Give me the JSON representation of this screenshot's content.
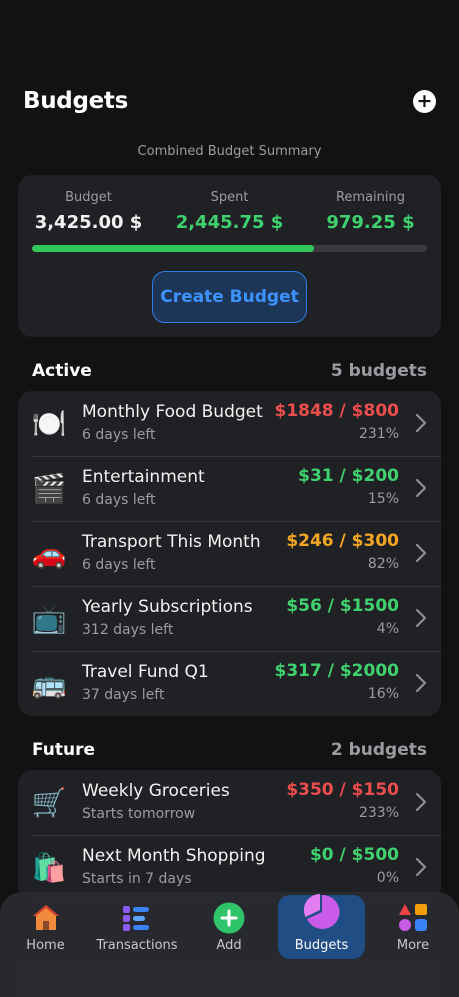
{
  "header": {
    "title": "Budgets",
    "add_icon": "plus-circle-icon"
  },
  "summary": {
    "caption": "Combined Budget Summary",
    "budget_label": "Budget",
    "budget_value": "3,425.00 $",
    "spent_label": "Spent",
    "spent_value": "2,445.75 $",
    "remaining_label": "Remaining",
    "remaining_value": "979.25 $",
    "progress_fraction": 0.714,
    "create_button": "Create Budget"
  },
  "active": {
    "title": "Active",
    "count": "5 budgets",
    "items": [
      {
        "icon": "🍽️",
        "icon_name": "plate-cutlery-icon",
        "name": "Monthly Food Budget",
        "sub": "6 days left",
        "amount": "$1848 / $800",
        "pct": "231%",
        "status": "red"
      },
      {
        "icon": "🎬",
        "icon_name": "clapperboard-icon",
        "name": "Entertainment",
        "sub": "6 days left",
        "amount": "$31 / $200",
        "pct": "15%",
        "status": "green"
      },
      {
        "icon": "🚗",
        "icon_name": "car-icon",
        "name": "Transport This Month",
        "sub": "6 days left",
        "amount": "$246 / $300",
        "pct": "82%",
        "status": "orange"
      },
      {
        "icon": "📺",
        "icon_name": "television-icon",
        "name": "Yearly Subscriptions",
        "sub": "312 days left",
        "amount": "$56 / $1500",
        "pct": "4%",
        "status": "green"
      },
      {
        "icon": "🚌",
        "icon_name": "bus-icon",
        "name": "Travel Fund Q1",
        "sub": "37 days left",
        "amount": "$317 / $2000",
        "pct": "16%",
        "status": "green"
      }
    ]
  },
  "future": {
    "title": "Future",
    "count": "2 budgets",
    "items": [
      {
        "icon": "🛒",
        "icon_name": "shopping-cart-icon",
        "name": "Weekly Groceries",
        "sub": "Starts tomorrow",
        "amount": "$350 / $150",
        "pct": "233%",
        "status": "red"
      },
      {
        "icon": "🛍️",
        "icon_name": "shopping-bags-icon",
        "name": "Next Month Shopping",
        "sub": "Starts in 7 days",
        "amount": "$0 / $500",
        "pct": "0%",
        "status": "green"
      }
    ]
  },
  "tabbar": {
    "home": "Home",
    "transactions": "Transactions",
    "add": "Add",
    "budgets": "Budgets",
    "more": "More",
    "active_tab": "budgets"
  },
  "colors": {
    "accent": "#3d93ff",
    "green": "#3fd16e",
    "red": "#ee4d4d",
    "orange": "#f5a623",
    "background": "#121213",
    "card": "#202125"
  }
}
